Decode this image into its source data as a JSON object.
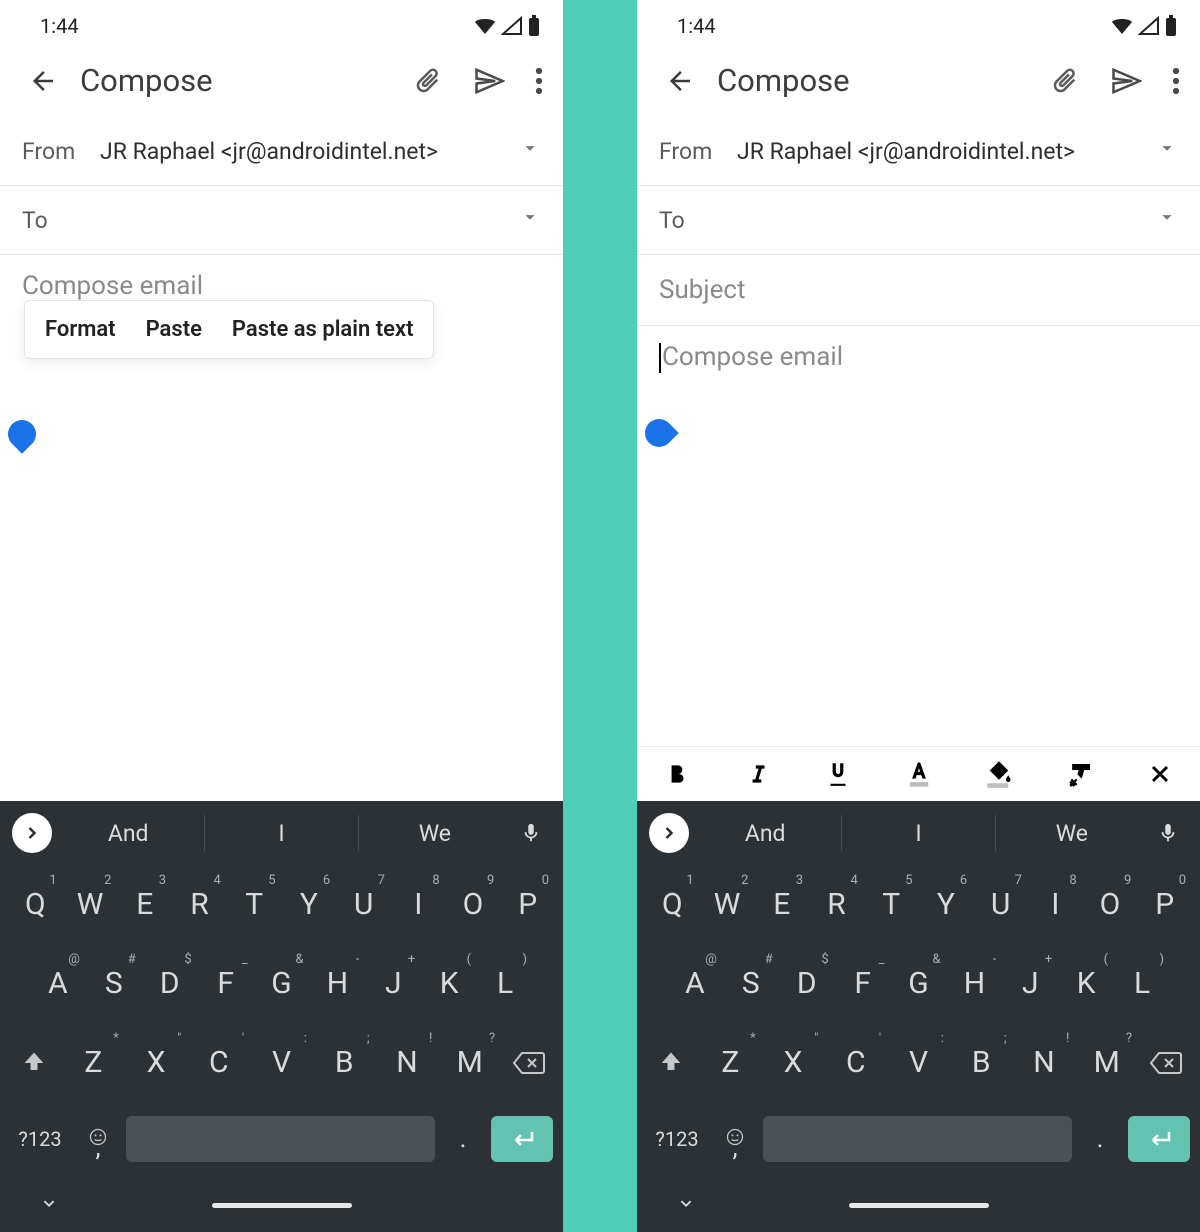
{
  "status": {
    "time": "1:44"
  },
  "appbar": {
    "title": "Compose"
  },
  "fields": {
    "from_label": "From",
    "from_value": "JR Raphael <jr@androidintel.net>",
    "to_label": "To",
    "subject_placeholder": "Subject",
    "body_placeholder": "Compose email"
  },
  "context_menu": {
    "format": "Format",
    "paste": "Paste",
    "paste_plain": "Paste as plain text"
  },
  "suggestions": {
    "s1": "And",
    "s2": "I",
    "s3": "We"
  },
  "keys": {
    "row1": [
      {
        "l": "Q",
        "s": "1"
      },
      {
        "l": "W",
        "s": "2"
      },
      {
        "l": "E",
        "s": "3"
      },
      {
        "l": "R",
        "s": "4"
      },
      {
        "l": "T",
        "s": "5"
      },
      {
        "l": "Y",
        "s": "6"
      },
      {
        "l": "U",
        "s": "7"
      },
      {
        "l": "I",
        "s": "8"
      },
      {
        "l": "O",
        "s": "9"
      },
      {
        "l": "P",
        "s": "0"
      }
    ],
    "row2": [
      {
        "l": "A",
        "s": "@"
      },
      {
        "l": "S",
        "s": "#"
      },
      {
        "l": "D",
        "s": "$"
      },
      {
        "l": "F",
        "s": "_"
      },
      {
        "l": "G",
        "s": "&"
      },
      {
        "l": "H",
        "s": "-"
      },
      {
        "l": "J",
        "s": "+"
      },
      {
        "l": "K",
        "s": "("
      },
      {
        "l": "L",
        "s": ")"
      }
    ],
    "row3": [
      {
        "l": "Z",
        "s": "*"
      },
      {
        "l": "X",
        "s": "\""
      },
      {
        "l": "C",
        "s": "'"
      },
      {
        "l": "V",
        "s": ":"
      },
      {
        "l": "B",
        "s": ";"
      },
      {
        "l": "N",
        "s": "!"
      },
      {
        "l": "M",
        "s": "?"
      }
    ],
    "sym": "?123",
    "period": "."
  }
}
